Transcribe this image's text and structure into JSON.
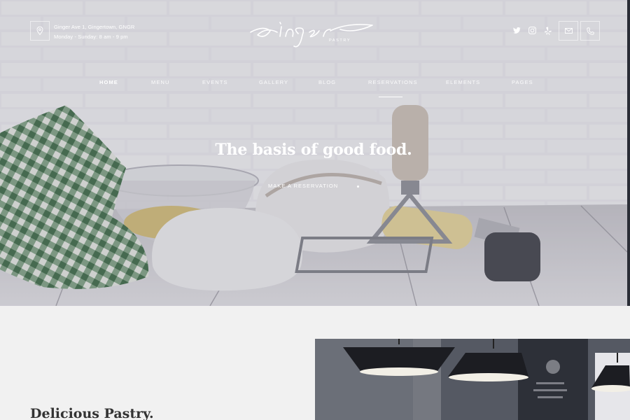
{
  "header": {
    "address": "Ginger Ave 1, Gingertown, GNGR",
    "hours": "Monday - Sunday: 8 am - 9 pm",
    "logo_text": "ginger",
    "logo_subtitle": "PASTRY"
  },
  "nav": {
    "items": [
      {
        "label": "HOME"
      },
      {
        "label": "MENU"
      },
      {
        "label": "EVENTS"
      },
      {
        "label": "GALLERY"
      },
      {
        "label": "BLOG"
      },
      {
        "label": "RESERVATIONS"
      },
      {
        "label": "ELEMENTS"
      },
      {
        "label": "PAGES"
      }
    ]
  },
  "hero": {
    "headline": "The basis of good food.",
    "cta": "MAKE A RESERVATION"
  },
  "content": {
    "section_title": "Delicious Pastry."
  },
  "icons": {
    "location": "location-pin-icon",
    "twitter": "twitter-icon",
    "instagram": "instagram-icon",
    "yelp": "yelp-icon",
    "mail": "mail-icon",
    "phone": "phone-icon"
  },
  "colors": {
    "text_light": "#ffffff",
    "text_dark": "#333333",
    "page_bg": "#f1f1f1"
  }
}
